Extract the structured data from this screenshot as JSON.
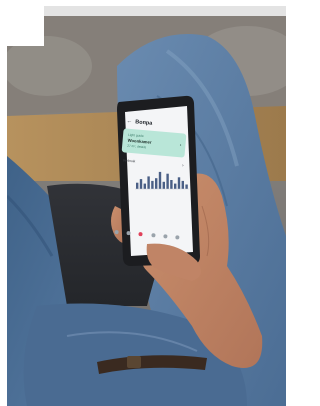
{
  "screen": {
    "title": "Вопра",
    "card": {
      "line1": "Light guide",
      "line2": "Woonkamer",
      "line3": "27 m², details"
    },
    "usage_label": "Verbruik"
  },
  "chart_data": {
    "type": "bar",
    "values": [
      0.35,
      0.55,
      0.3,
      0.7,
      0.45,
      0.6,
      0.95,
      0.4,
      0.85,
      0.5,
      0.3,
      0.65,
      0.45,
      0.25
    ]
  },
  "nav": {
    "count": 6,
    "active_index": 2,
    "active_color": "#e0415a"
  },
  "colors": {
    "card_bg": "#b9e6d8",
    "jeans": "#4d6f96"
  }
}
